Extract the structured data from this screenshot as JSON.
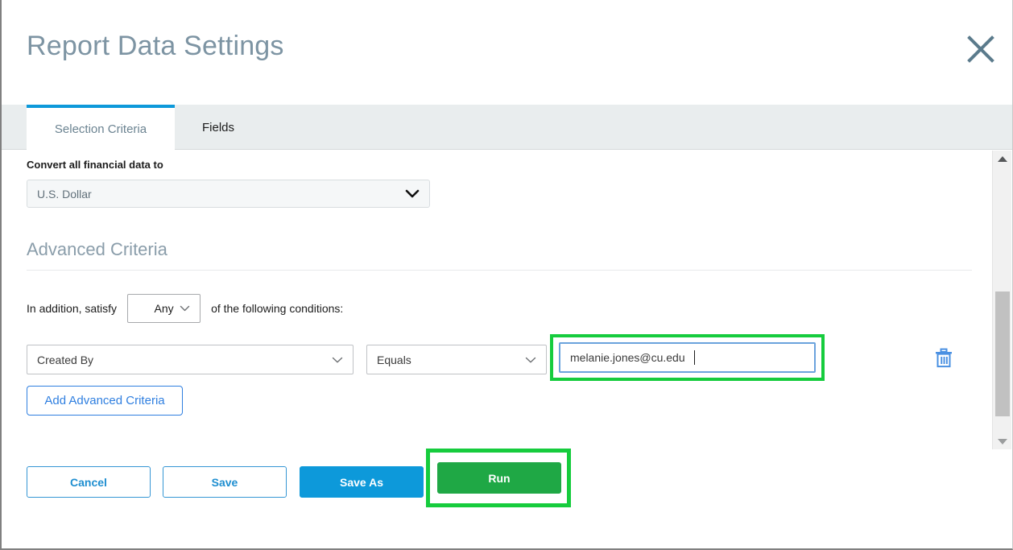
{
  "dialog": {
    "title": "Report Data Settings",
    "close_label": "Close",
    "close_icon": "close-x-icon"
  },
  "tabs": [
    {
      "label": "Selection Criteria",
      "active": true
    },
    {
      "label": "Fields",
      "active": false
    }
  ],
  "selection_criteria": {
    "currency": {
      "label": "Convert all financial data to",
      "value": "U.S. Dollar",
      "chevron_icon": "chevron-down-icon"
    },
    "advanced": {
      "heading": "Advanced Criteria",
      "satisfy_prefix": "In addition, satisfy",
      "satisfy_value": "Any",
      "satisfy_suffix": "of the following conditions:",
      "rows": [
        {
          "field": "Created By",
          "operator": "Equals",
          "value": "melanie.jones@cu.edu",
          "value_highlighted": true,
          "delete_icon": "trash-icon",
          "delete_label": "Delete condition"
        }
      ],
      "add_button": "Add Advanced Criteria"
    }
  },
  "footer": {
    "cancel": "Cancel",
    "save": "Save",
    "save_as": "Save As",
    "run": "Run"
  },
  "scrollbar": {
    "up_icon": "scroll-up-arrow-icon",
    "down_icon": "scroll-down-arrow-icon"
  },
  "colors": {
    "title_gray_blue": "#7d94a3",
    "accent_blue": "#0d99da",
    "link_blue": "#2f7fe0",
    "run_green": "#1fa845",
    "highlight_green": "#16cc3d",
    "tabbar_gray": "#e9edee"
  }
}
